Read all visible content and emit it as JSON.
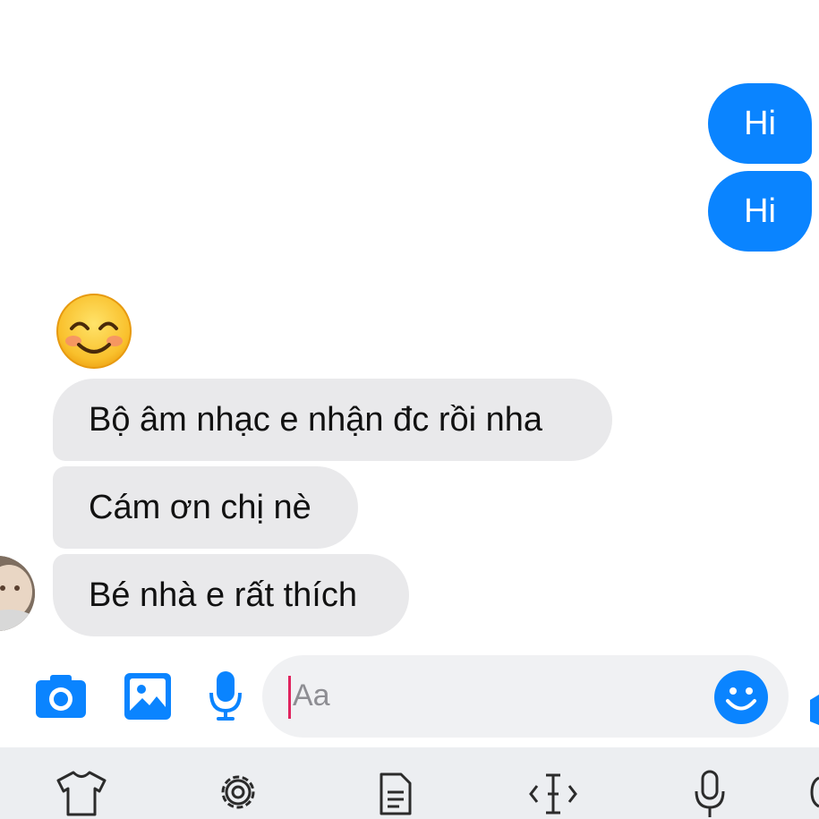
{
  "messages_out": [
    {
      "text": "Hi"
    },
    {
      "text": "Hi"
    }
  ],
  "messages_in": [
    {
      "text": "Bộ âm nhạc e nhận đc rồi nha"
    },
    {
      "text": "Cám ơn chị nè"
    },
    {
      "text": "Bé nhà e rất thích"
    }
  ],
  "compose": {
    "placeholder": "Aa",
    "icons": [
      "camera-icon",
      "gallery-icon",
      "microphone-icon",
      "emoji-icon",
      "send-icon"
    ]
  },
  "keyboard_toolbar": {
    "icons": [
      "theme-shirt-icon",
      "settings-gear-icon",
      "clipboard-icon",
      "cursor-control-icon",
      "voice-input-icon",
      "more-icon"
    ]
  },
  "colors": {
    "accent": "#0a84ff",
    "incoming_bubble": "#e9e9eb",
    "caret": "#e0245e",
    "keyboard_bar": "#eceef1"
  }
}
